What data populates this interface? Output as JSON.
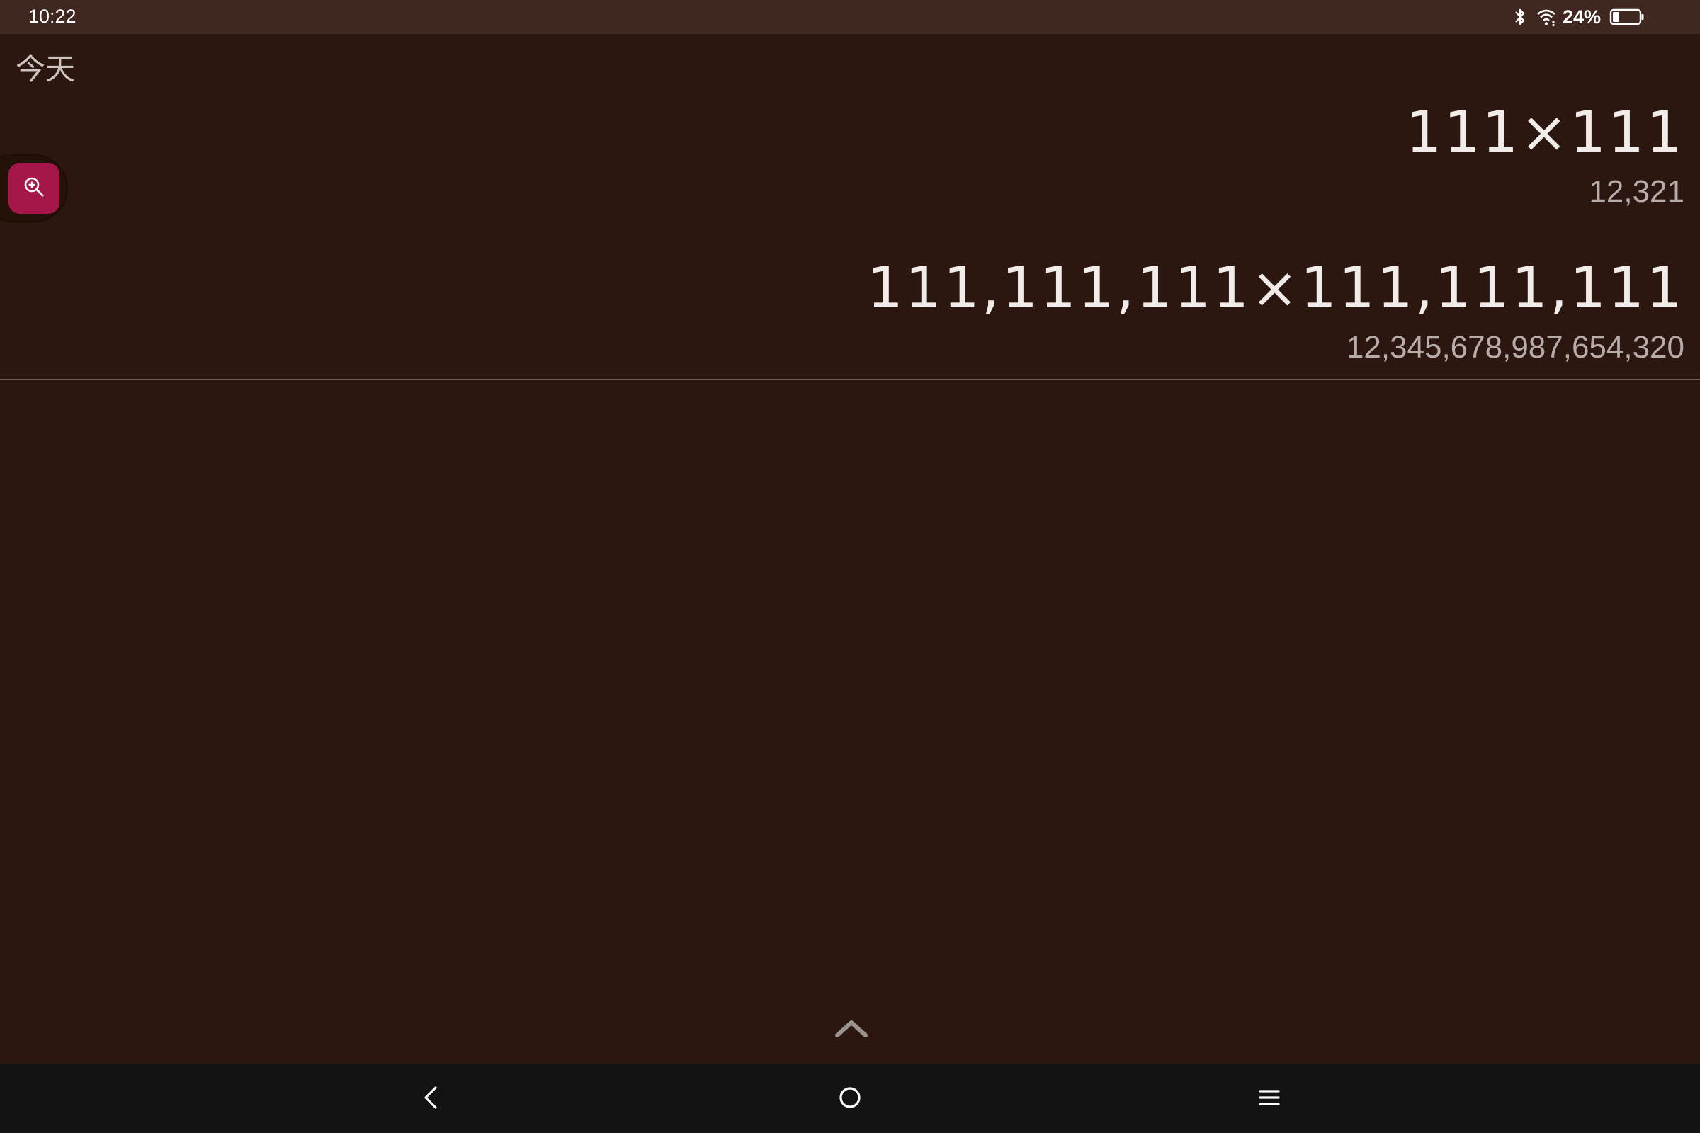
{
  "status_bar": {
    "time": "10:22",
    "battery_percent": "24%",
    "battery_level": 0.24,
    "icons": [
      "bluetooth-icon",
      "wifi-icon",
      "battery-icon"
    ]
  },
  "history": {
    "header": "今天",
    "entries": [
      {
        "expression": "111×111",
        "result": "12,321"
      },
      {
        "expression": "111,111,111×111,111,111",
        "result": "12,345,678,987,654,320"
      }
    ]
  },
  "zoom_button": {
    "icon": "zoom-in-icon",
    "color": "#a5174a"
  },
  "expand_handle": {
    "icon": "chevron-up-icon"
  },
  "nav_bar": {
    "back": "back-icon",
    "home": "home-icon",
    "recents": "menu-icon"
  },
  "colors": {
    "background": "#2b170f",
    "status_bar": "#402820",
    "accent": "#a5174a",
    "nav_bar": "#131313"
  }
}
